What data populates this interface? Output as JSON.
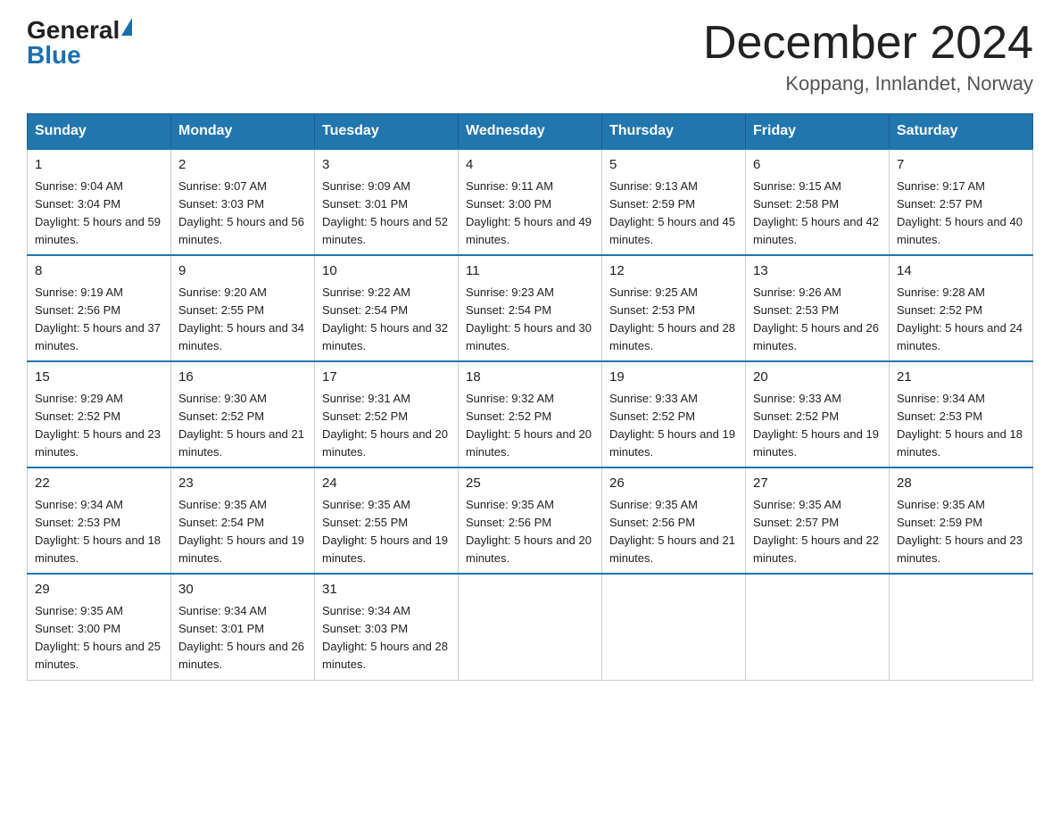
{
  "header": {
    "logo_general": "General",
    "logo_blue": "Blue",
    "title": "December 2024",
    "subtitle": "Koppang, Innlandet, Norway"
  },
  "weekdays": [
    "Sunday",
    "Monday",
    "Tuesday",
    "Wednesday",
    "Thursday",
    "Friday",
    "Saturday"
  ],
  "weeks": [
    [
      {
        "day": "1",
        "sunrise": "9:04 AM",
        "sunset": "3:04 PM",
        "daylight": "5 hours and 59 minutes."
      },
      {
        "day": "2",
        "sunrise": "9:07 AM",
        "sunset": "3:03 PM",
        "daylight": "5 hours and 56 minutes."
      },
      {
        "day": "3",
        "sunrise": "9:09 AM",
        "sunset": "3:01 PM",
        "daylight": "5 hours and 52 minutes."
      },
      {
        "day": "4",
        "sunrise": "9:11 AM",
        "sunset": "3:00 PM",
        "daylight": "5 hours and 49 minutes."
      },
      {
        "day": "5",
        "sunrise": "9:13 AM",
        "sunset": "2:59 PM",
        "daylight": "5 hours and 45 minutes."
      },
      {
        "day": "6",
        "sunrise": "9:15 AM",
        "sunset": "2:58 PM",
        "daylight": "5 hours and 42 minutes."
      },
      {
        "day": "7",
        "sunrise": "9:17 AM",
        "sunset": "2:57 PM",
        "daylight": "5 hours and 40 minutes."
      }
    ],
    [
      {
        "day": "8",
        "sunrise": "9:19 AM",
        "sunset": "2:56 PM",
        "daylight": "5 hours and 37 minutes."
      },
      {
        "day": "9",
        "sunrise": "9:20 AM",
        "sunset": "2:55 PM",
        "daylight": "5 hours and 34 minutes."
      },
      {
        "day": "10",
        "sunrise": "9:22 AM",
        "sunset": "2:54 PM",
        "daylight": "5 hours and 32 minutes."
      },
      {
        "day": "11",
        "sunrise": "9:23 AM",
        "sunset": "2:54 PM",
        "daylight": "5 hours and 30 minutes."
      },
      {
        "day": "12",
        "sunrise": "9:25 AM",
        "sunset": "2:53 PM",
        "daylight": "5 hours and 28 minutes."
      },
      {
        "day": "13",
        "sunrise": "9:26 AM",
        "sunset": "2:53 PM",
        "daylight": "5 hours and 26 minutes."
      },
      {
        "day": "14",
        "sunrise": "9:28 AM",
        "sunset": "2:52 PM",
        "daylight": "5 hours and 24 minutes."
      }
    ],
    [
      {
        "day": "15",
        "sunrise": "9:29 AM",
        "sunset": "2:52 PM",
        "daylight": "5 hours and 23 minutes."
      },
      {
        "day": "16",
        "sunrise": "9:30 AM",
        "sunset": "2:52 PM",
        "daylight": "5 hours and 21 minutes."
      },
      {
        "day": "17",
        "sunrise": "9:31 AM",
        "sunset": "2:52 PM",
        "daylight": "5 hours and 20 minutes."
      },
      {
        "day": "18",
        "sunrise": "9:32 AM",
        "sunset": "2:52 PM",
        "daylight": "5 hours and 20 minutes."
      },
      {
        "day": "19",
        "sunrise": "9:33 AM",
        "sunset": "2:52 PM",
        "daylight": "5 hours and 19 minutes."
      },
      {
        "day": "20",
        "sunrise": "9:33 AM",
        "sunset": "2:52 PM",
        "daylight": "5 hours and 19 minutes."
      },
      {
        "day": "21",
        "sunrise": "9:34 AM",
        "sunset": "2:53 PM",
        "daylight": "5 hours and 18 minutes."
      }
    ],
    [
      {
        "day": "22",
        "sunrise": "9:34 AM",
        "sunset": "2:53 PM",
        "daylight": "5 hours and 18 minutes."
      },
      {
        "day": "23",
        "sunrise": "9:35 AM",
        "sunset": "2:54 PM",
        "daylight": "5 hours and 19 minutes."
      },
      {
        "day": "24",
        "sunrise": "9:35 AM",
        "sunset": "2:55 PM",
        "daylight": "5 hours and 19 minutes."
      },
      {
        "day": "25",
        "sunrise": "9:35 AM",
        "sunset": "2:56 PM",
        "daylight": "5 hours and 20 minutes."
      },
      {
        "day": "26",
        "sunrise": "9:35 AM",
        "sunset": "2:56 PM",
        "daylight": "5 hours and 21 minutes."
      },
      {
        "day": "27",
        "sunrise": "9:35 AM",
        "sunset": "2:57 PM",
        "daylight": "5 hours and 22 minutes."
      },
      {
        "day": "28",
        "sunrise": "9:35 AM",
        "sunset": "2:59 PM",
        "daylight": "5 hours and 23 minutes."
      }
    ],
    [
      {
        "day": "29",
        "sunrise": "9:35 AM",
        "sunset": "3:00 PM",
        "daylight": "5 hours and 25 minutes."
      },
      {
        "day": "30",
        "sunrise": "9:34 AM",
        "sunset": "3:01 PM",
        "daylight": "5 hours and 26 minutes."
      },
      {
        "day": "31",
        "sunrise": "9:34 AM",
        "sunset": "3:03 PM",
        "daylight": "5 hours and 28 minutes."
      },
      null,
      null,
      null,
      null
    ]
  ]
}
